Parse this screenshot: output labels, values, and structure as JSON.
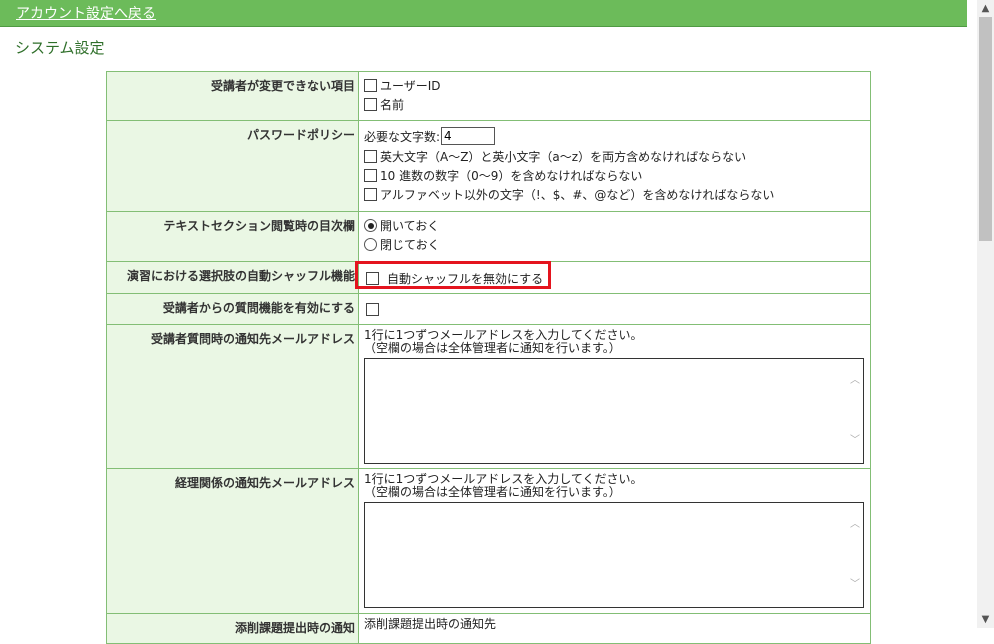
{
  "nav": {
    "back_link": "アカウント設定へ戻る"
  },
  "page": {
    "title": "システム設定"
  },
  "rows": {
    "restrict": {
      "label": "受講者が変更できない項目",
      "options": [
        "ユーザーID",
        "名前"
      ]
    },
    "password": {
      "label": "パスワードポリシー",
      "min_chars_label": "必要な文字数:",
      "min_chars_value": "4",
      "rules": [
        "英大文字（A～Z）と英小文字（a～z）を両方含めなければならない",
        "10 進数の数字（0～9）を含めなければならない",
        "アルファベット以外の文字（!、$、#、@など）を含めなければならない"
      ]
    },
    "toc": {
      "label": "テキストセクション閲覧時の目次欄",
      "options": [
        "開いておく",
        "閉じておく"
      ],
      "selected": 0
    },
    "shuffle": {
      "label": "演習における選択肢の自動シャッフル機能",
      "option": "自動シャッフルを無効にする"
    },
    "question": {
      "label": "受講者からの質問機能を有効にする"
    },
    "notify_email": {
      "label": "受講者質問時の通知先メールアドレス",
      "note1": "1行に1つずつメールアドレスを入力してください。",
      "note2": "（空欄の場合は全体管理者に通知を行います。）"
    },
    "accounting_email": {
      "label": "経理関係の通知先メールアドレス",
      "note1": "1行に1つずつメールアドレスを入力してください。",
      "note2": "（空欄の場合は全体管理者に通知を行います。）"
    },
    "homework": {
      "label": "添削課題提出時の通知",
      "value": "添削課題提出時の通知先"
    }
  },
  "colors": {
    "accent": "#6cbb5a",
    "label_bg": "#eaf7e4",
    "border": "#83be75",
    "highlight": "#e4141e"
  }
}
